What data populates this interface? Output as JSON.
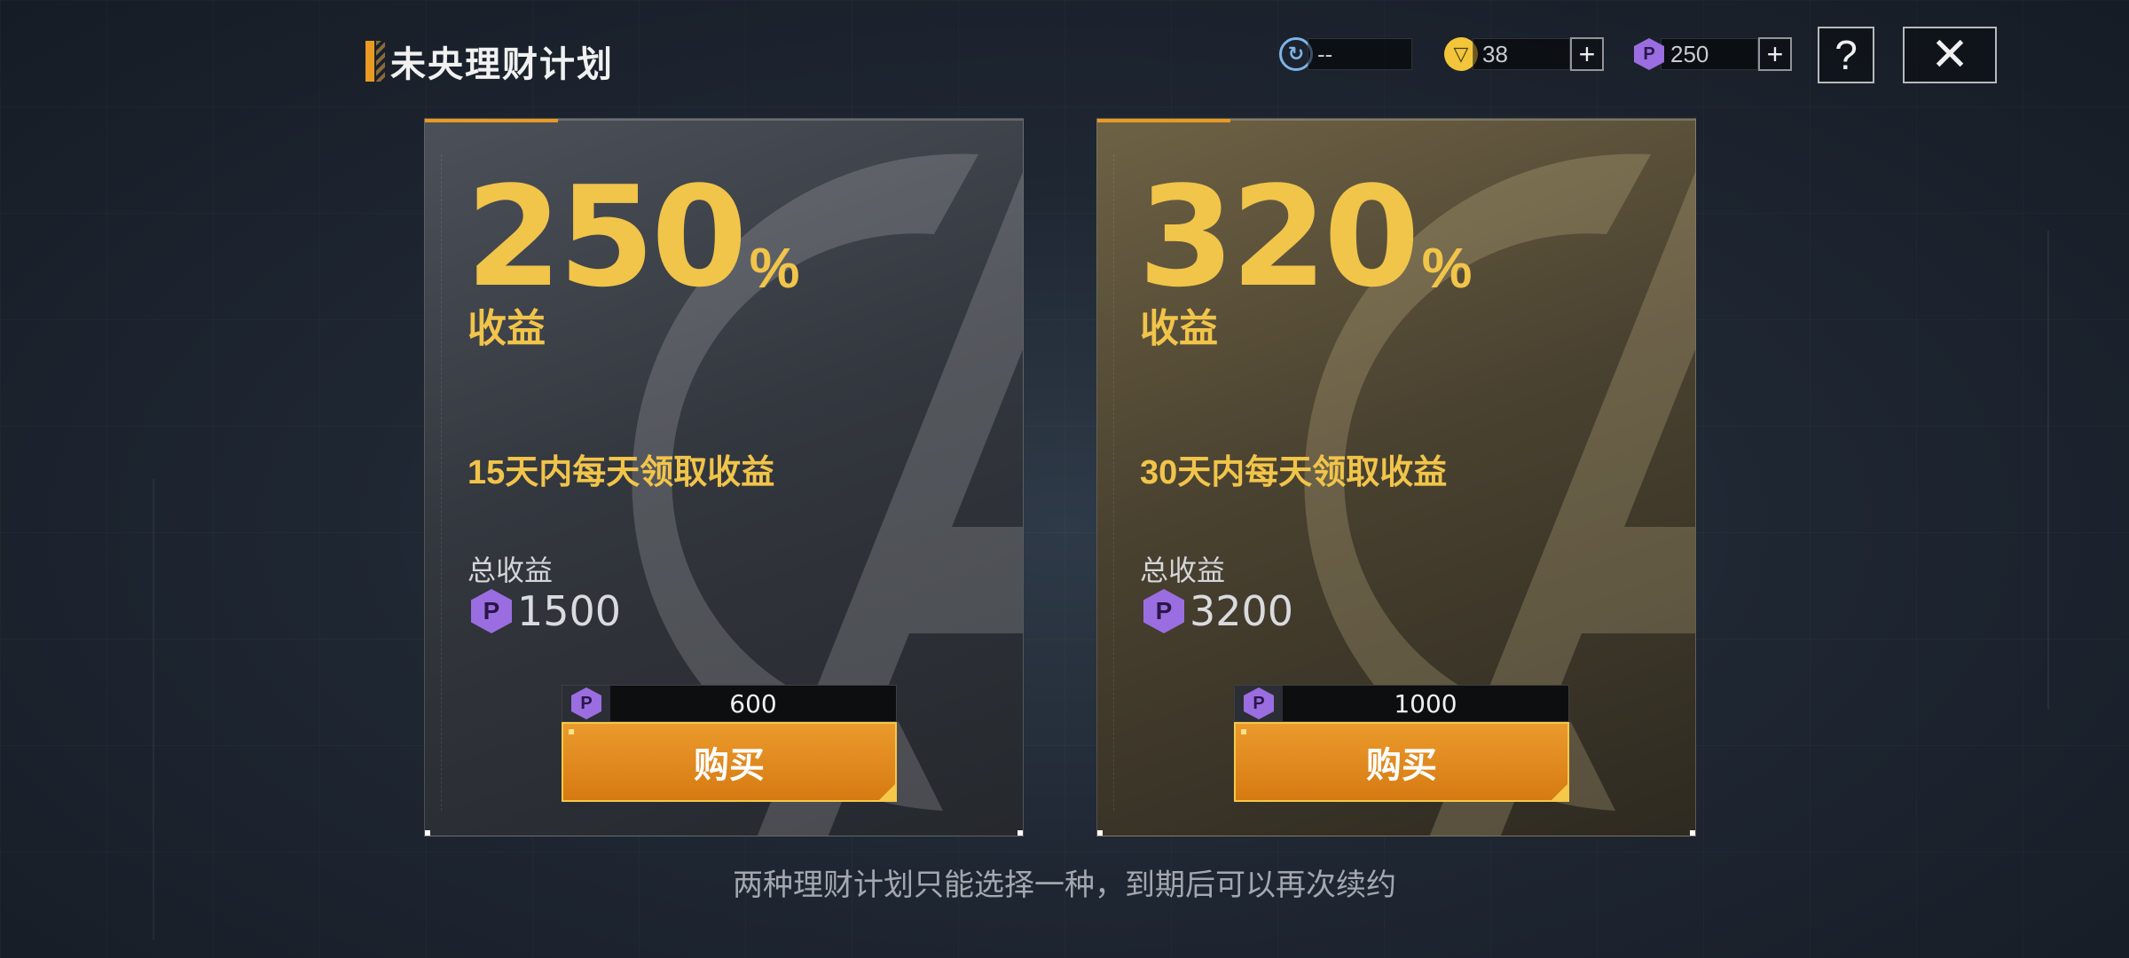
{
  "header": {
    "title": "未央理财计划",
    "currencies": [
      {
        "icon": "refresh-icon",
        "value": "--",
        "has_plus": false
      },
      {
        "icon": "gold-coin-icon",
        "value": "38",
        "has_plus": true
      },
      {
        "icon": "p-coin-icon",
        "value": "250",
        "has_plus": true
      }
    ],
    "plus_label": "+",
    "help_label": "?",
    "close_label": "✕"
  },
  "plans": [
    {
      "percent": "250",
      "percent_sign": "%",
      "yield_label": "收益",
      "daily_text": "15天内每天领取收益",
      "total_label": "总收益",
      "total_value": "1500",
      "price": "600",
      "buy_label": "购买"
    },
    {
      "percent": "320",
      "percent_sign": "%",
      "yield_label": "收益",
      "daily_text": "30天内每天领取收益",
      "total_label": "总收益",
      "total_value": "3200",
      "price": "1000",
      "buy_label": "购买"
    }
  ],
  "footer_note": "两种理财计划只能选择一种，到期后可以再次续约",
  "colors": {
    "accent_gold": "#f1c44a",
    "button_orange": "#e08a1e",
    "p_coin_purple": "#9a6ee0"
  }
}
